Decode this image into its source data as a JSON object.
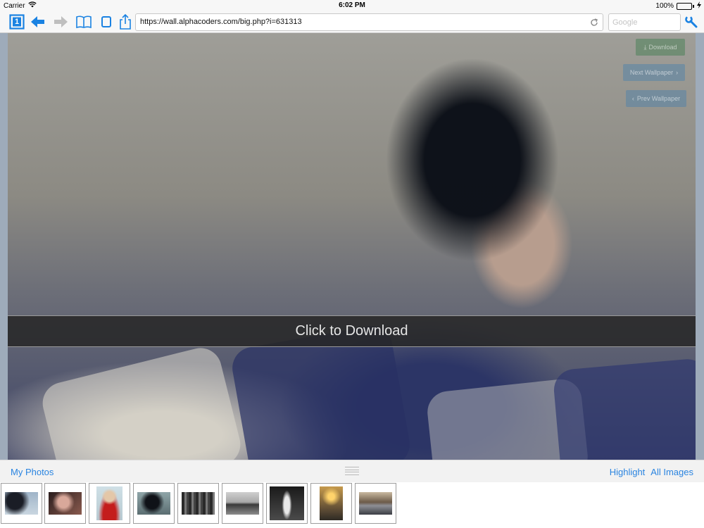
{
  "status_bar": {
    "carrier": "Carrier",
    "time": "6:02 PM",
    "battery": "100%",
    "battery_level": 1.0
  },
  "toolbar": {
    "tab_count": "1",
    "url": "https://wall.alphacoders.com/big.php?i=631313",
    "search_placeholder": "Google",
    "icons": [
      "tabs-icon",
      "back-arrow-icon",
      "forward-arrow-icon",
      "bookmarks-icon",
      "page-icon",
      "share-icon",
      "reload-icon",
      "wrench-icon"
    ],
    "accent_color": "#1a82e2"
  },
  "content": {
    "click_to_download": "Click to Download",
    "download_button": "Download",
    "next_wallpaper_button": "Next Wallpaper",
    "prev_wallpaper_button": "Prev Wallpaper"
  },
  "bottom_bar": {
    "my_photos": "My Photos",
    "highlight": "Highlight",
    "all_images": "All Images"
  },
  "thumbnails": [
    {
      "subject": "woman-portrait-dark-hair"
    },
    {
      "subject": "woman-portrait-red"
    },
    {
      "subject": "woman-red-dress"
    },
    {
      "subject": "woman-dark-hair"
    },
    {
      "subject": "forest-bw"
    },
    {
      "subject": "landscape-bw"
    },
    {
      "subject": "tower-bw"
    },
    {
      "subject": "road-sunset"
    },
    {
      "subject": "lake-town"
    }
  ]
}
